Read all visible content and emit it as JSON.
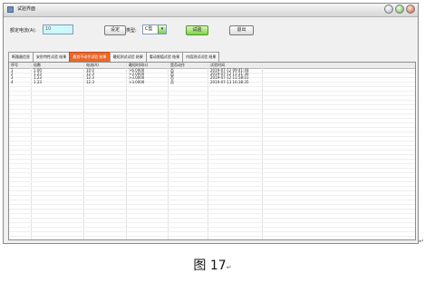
{
  "window": {
    "title": "试验界面"
  },
  "form": {
    "rated_current_label": "额定电流(A):",
    "rated_current_value": "10",
    "set_button": "设定",
    "type_label": "类型:",
    "type_value": "C型",
    "test_button": "试验",
    "exit_button": "退出"
  },
  "tabs": [
    {
      "label": "断路器信息"
    },
    {
      "label": "安秒特性试验 结果"
    },
    {
      "label": "最良不动作试验 结果"
    },
    {
      "label": "最短测试试验 结果"
    },
    {
      "label": "看动限值试验 结果"
    },
    {
      "label": "内阻测试试验 结果"
    }
  ],
  "active_tab": 2,
  "table": {
    "columns": [
      "序号",
      "倍数",
      "电流(A)",
      "最短时间(s)",
      "是否动作",
      "试验时间"
    ],
    "rows": [
      [
        "1",
        "1.00",
        "10.0",
        ">6.0000",
        "否",
        "2019-07-12 09:41:48"
      ],
      [
        "2",
        "1.23",
        "12.3",
        ">3.0000",
        "否",
        "2019-07-12 11:21:36"
      ],
      [
        "3",
        "1.23",
        "12.3",
        ">3.0000",
        "否",
        "2019-07-12 11:58:01"
      ],
      [
        "4",
        "1.23",
        "12.3",
        ">3.0000",
        "否",
        "2019-07-13 16:38:35"
      ]
    ]
  },
  "caption": {
    "text": "图 17",
    "mark": "↵"
  },
  "side_mark": "↵",
  "colors": {
    "active_tab": "#e9672a",
    "test_button": "#7fd14b",
    "input_highlight": "#cdf7f9"
  }
}
